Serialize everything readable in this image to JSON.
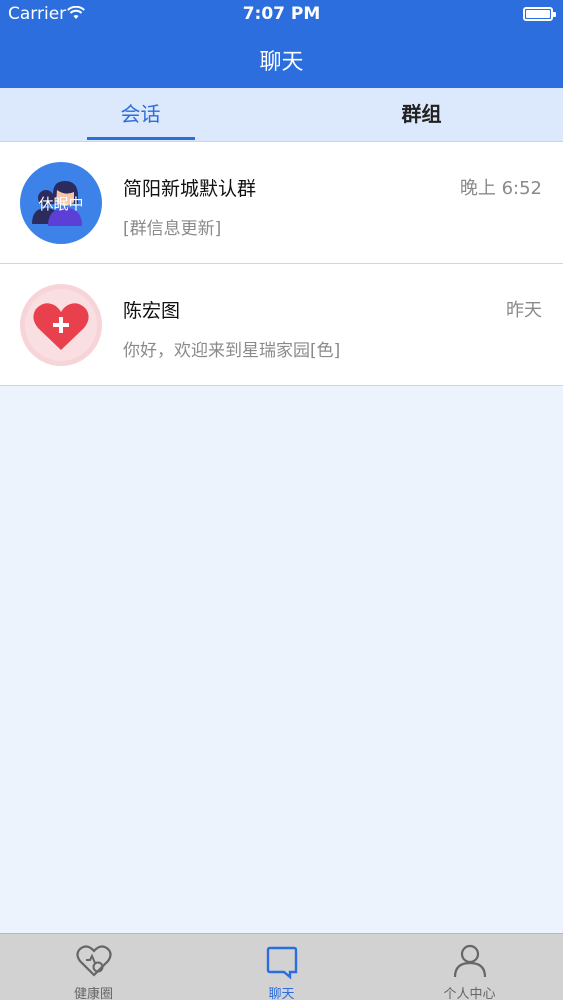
{
  "status_bar": {
    "carrier": "Carrier",
    "time": "7:07 PM",
    "wifi_icon": "wifi-icon",
    "battery_icon": "battery-icon"
  },
  "nav": {
    "title": "聊天"
  },
  "tabs": [
    {
      "label": "会话",
      "active": true
    },
    {
      "label": "群组",
      "active": false
    }
  ],
  "conversations": [
    {
      "name": "简阳新城默认群",
      "time": "晚上 6:52",
      "preview": "[群信息更新]",
      "avatar": "group-avatar-icon",
      "avatar_status": "休眠中"
    },
    {
      "name": "陈宏图",
      "time": "昨天",
      "preview": "你好，欢迎来到星瑞家园[色]",
      "avatar": "heart-plus-icon"
    }
  ],
  "tabbar": [
    {
      "label": "健康圈",
      "icon": "heart-health-icon",
      "active": false
    },
    {
      "label": "聊天",
      "icon": "chat-bubble-icon",
      "active": true
    },
    {
      "label": "个人中心",
      "icon": "person-icon",
      "active": false
    }
  ],
  "colors": {
    "primary": "#2d6ede",
    "tab_bg": "#dce8fb",
    "page_bg": "#edf3fc",
    "tabbar_bg": "#d2d2d2"
  }
}
